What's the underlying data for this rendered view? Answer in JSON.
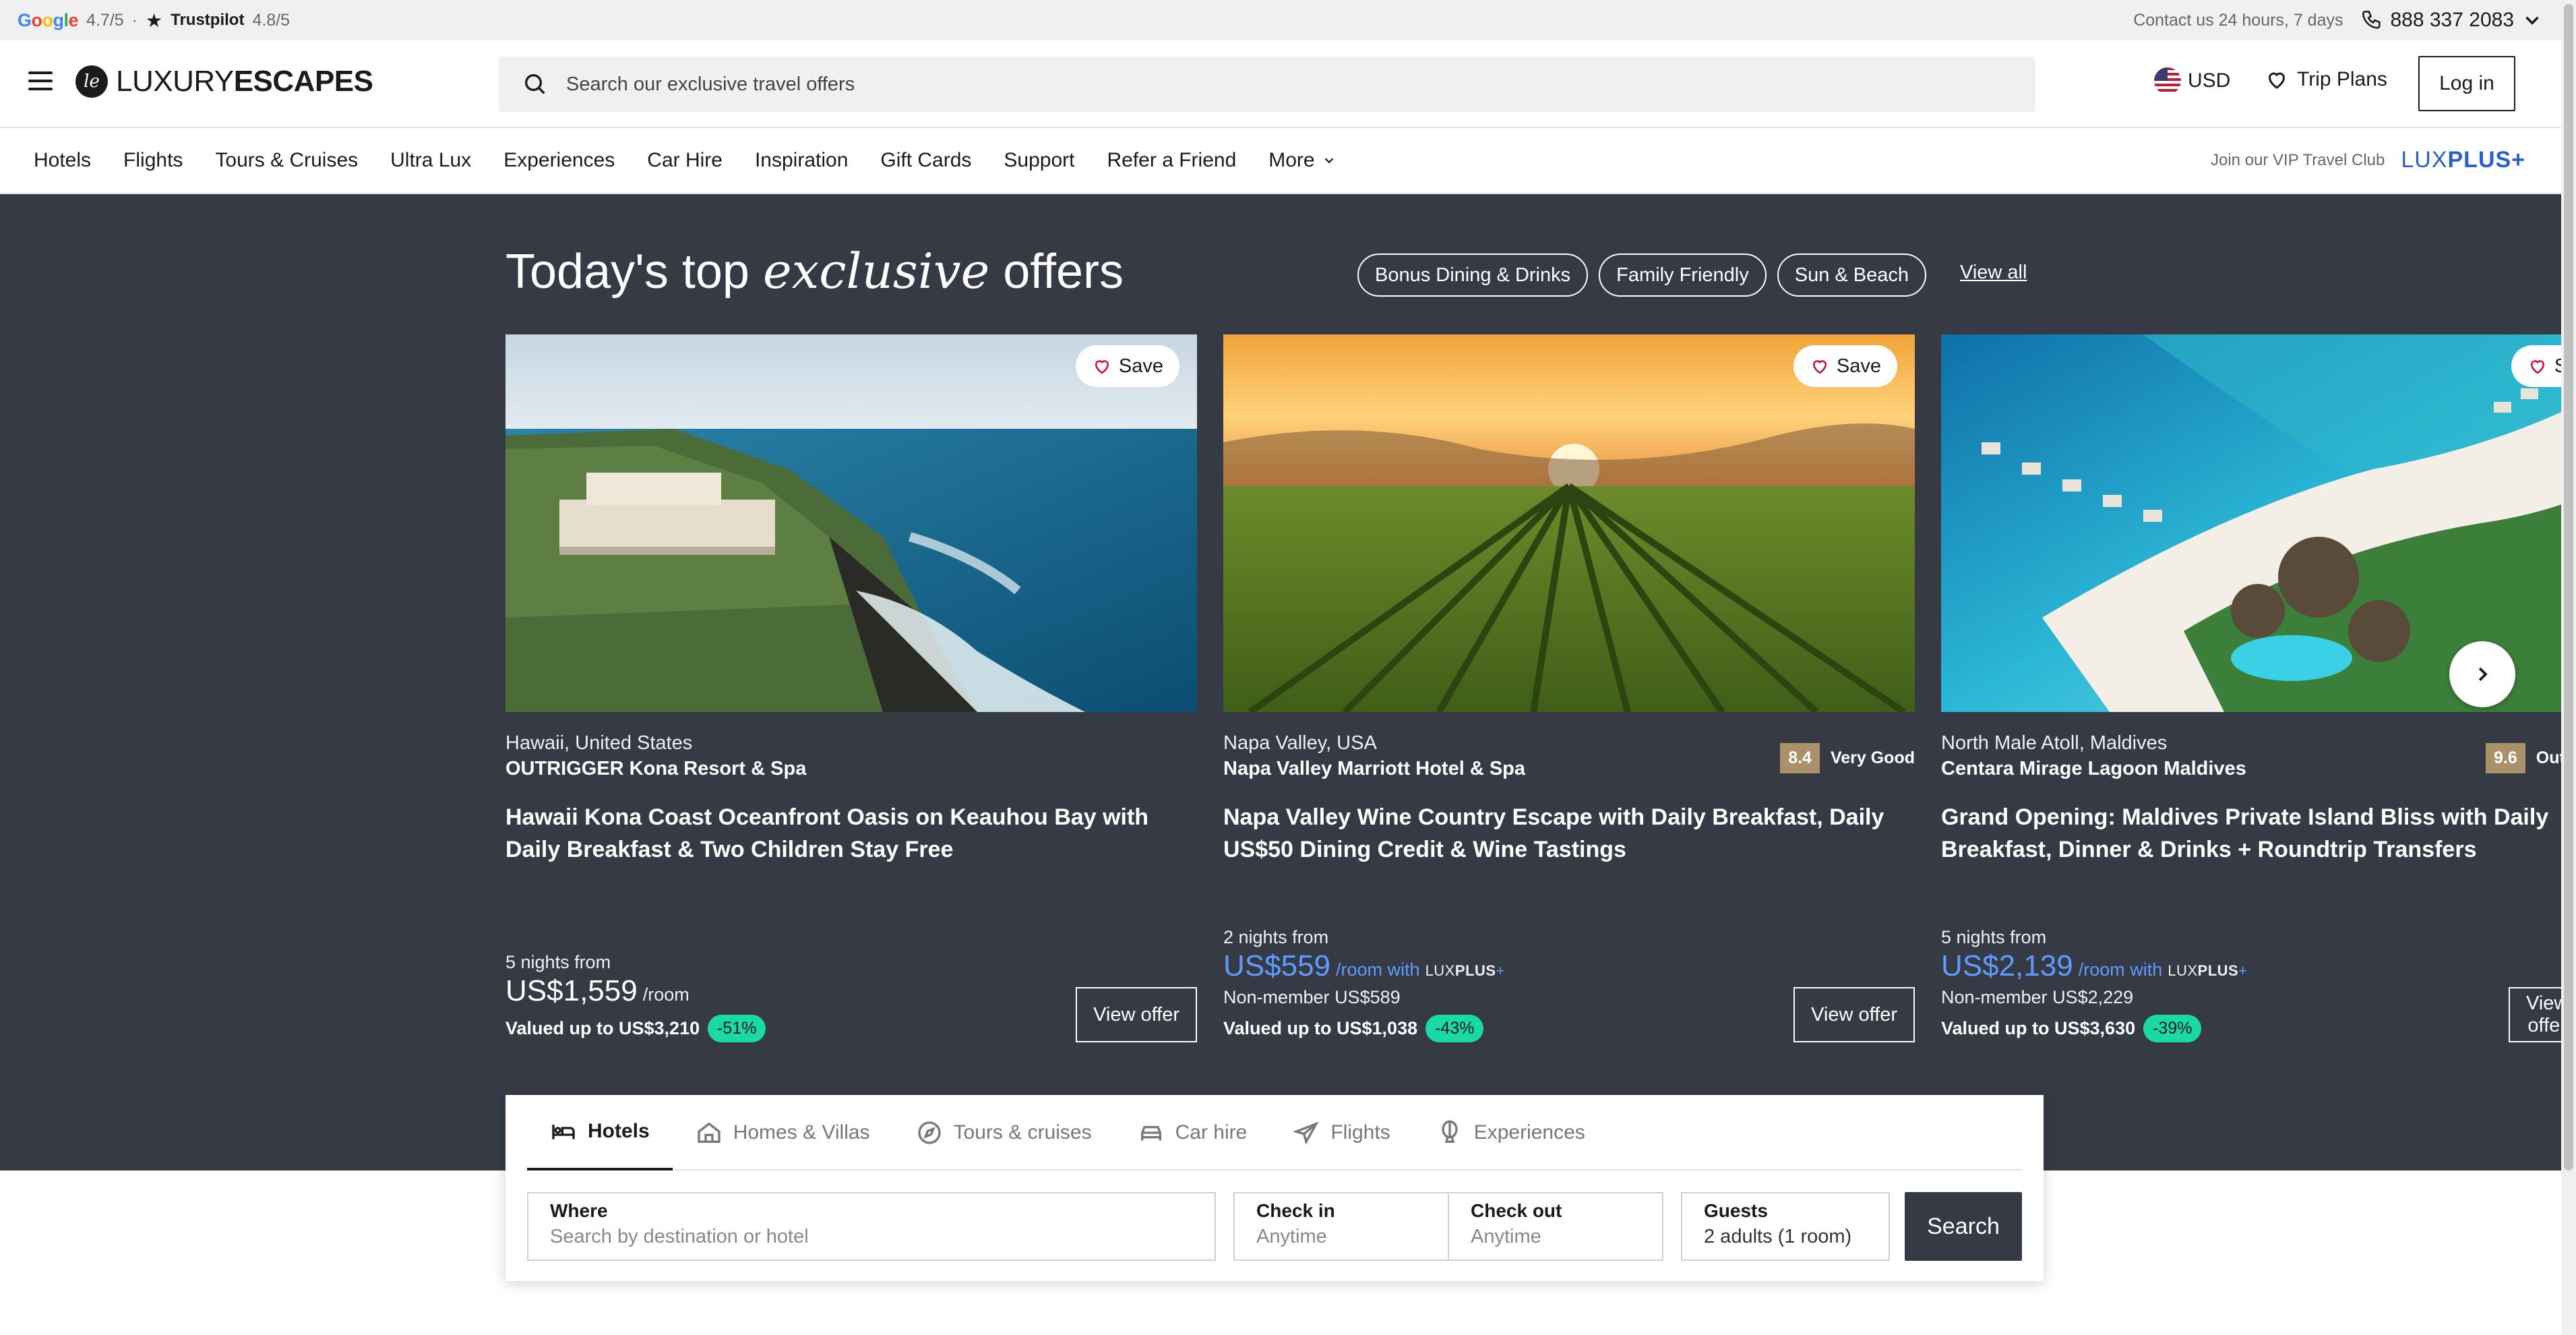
{
  "topbar": {
    "google_rating": "4.7/5",
    "separator": "·",
    "trustpilot_name": "Trustpilot",
    "trustpilot_rating": "4.8/5",
    "contact_text": "Contact us 24 hours, 7 days",
    "phone": "888 337 2083"
  },
  "header": {
    "logo_light": "LUXURY",
    "logo_bold": "ESCAPES",
    "search_placeholder": "Search our exclusive travel offers",
    "currency": "USD",
    "trip_plans": "Trip Plans",
    "login": "Log in"
  },
  "nav": {
    "items": [
      "Hotels",
      "Flights",
      "Tours & Cruises",
      "Ultra Lux",
      "Experiences",
      "Car Hire",
      "Inspiration",
      "Gift Cards",
      "Support",
      "Refer a Friend",
      "More"
    ],
    "vip_text": "Join our VIP Travel Club",
    "luxplus_light": "LUX",
    "luxplus_bold": "PLUS+"
  },
  "hero": {
    "title_start": "Today's top ",
    "title_em": "exclusive",
    "title_end": " offers",
    "chips": [
      "Bonus Dining & Drinks",
      "Family Friendly",
      "Sun & Beach"
    ],
    "view_all": "View all"
  },
  "offers": [
    {
      "save": "Save",
      "location": "Hawaii, United States",
      "property": "OUTRIGGER Kona Resort & Spa",
      "title": "Hawaii Kona Coast Oceanfront Oasis on Keauhou Bay with Daily Breakfast & Two Children Stay Free",
      "nights": "5 nights from",
      "price": "US$1,559",
      "per": "/room",
      "valued": "Valued up to US$3,210",
      "discount": "-51%",
      "cta": "View offer"
    },
    {
      "save": "Save",
      "location": "Napa Valley, USA",
      "property": "Napa Valley Marriott Hotel & Spa",
      "rating_score": "8.4",
      "rating_label": "Very Good",
      "title": "Napa Valley Wine Country Escape with Daily Breakfast, Daily US$50 Dining Credit & Wine Tastings",
      "nights": "2 nights from",
      "price": "US$559",
      "per": "/room with",
      "lux_light": "LUX",
      "lux_bold": "PLUS",
      "lux_plus": "+",
      "nonmember_label": "Non-member",
      "nonmember_price": "US$589",
      "valued": "Valued up to US$1,038",
      "discount": "-43%",
      "cta": "View offer"
    },
    {
      "save": "Save",
      "location": "North Male Atoll, Maldives",
      "property": "Centara Mirage Lagoon Maldives",
      "rating_score": "9.6",
      "rating_label": "Outstanding",
      "title": "Grand Opening: Maldives Private Island Bliss with Daily Breakfast, Dinner & Drinks + Roundtrip Transfers",
      "nights": "5 nights from",
      "price": "US$2,139",
      "per": "/room with",
      "lux_light": "LUX",
      "lux_bold": "PLUS",
      "lux_plus": "+",
      "nonmember_label": "Non-member",
      "nonmember_price": "US$2,229",
      "valued": "Valued up to US$3,630",
      "discount": "-39%",
      "cta": "View offer"
    }
  ],
  "widget": {
    "tabs": [
      "Hotels",
      "Homes & Villas",
      "Tours & cruises",
      "Car hire",
      "Flights",
      "Experiences"
    ],
    "where_label": "Where",
    "where_placeholder": "Search by destination or hotel",
    "checkin_label": "Check in",
    "checkin_value": "Anytime",
    "checkout_label": "Check out",
    "checkout_value": "Anytime",
    "guests_label": "Guests",
    "guests_value": "2 adults (1 room)",
    "search": "Search"
  },
  "colors": {
    "hero_bg": "#363a45",
    "discount_badge": "#1ad9a6",
    "luxplus_blue": "#5d9bff",
    "rating_badge": "#a9916a"
  }
}
